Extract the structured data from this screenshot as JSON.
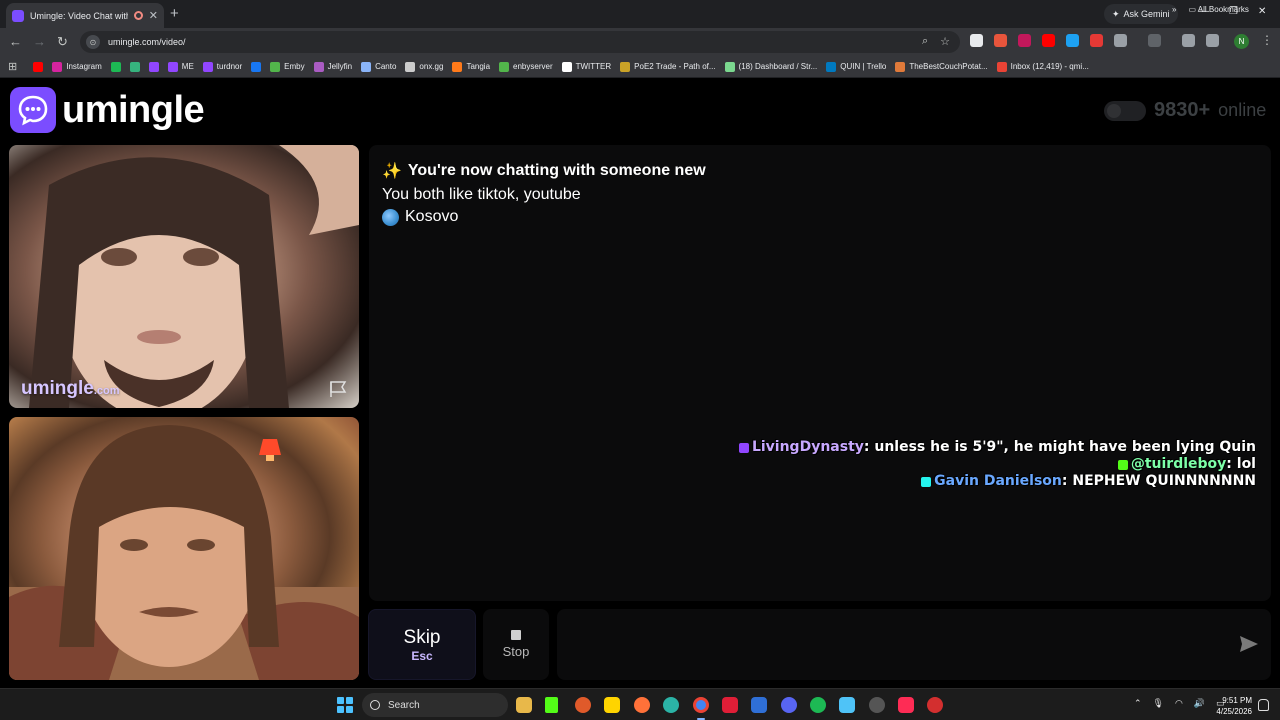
{
  "browser": {
    "tab_title": "Umingle: Video Chat with S",
    "url": "umingle.com/video/",
    "ask_gemini": "Ask Gemini",
    "profile_initial": "N",
    "bookmarks": [
      {
        "label": "",
        "color": "#ff0000"
      },
      {
        "label": "Instagram",
        "color": "#d6249f"
      },
      {
        "label": "",
        "color": "#1db954"
      },
      {
        "label": "",
        "color": "#36b37e"
      },
      {
        "label": "",
        "color": "#9146ff"
      },
      {
        "label": "ME",
        "color": "#9146ff"
      },
      {
        "label": "turdnor",
        "color": "#9146ff"
      },
      {
        "label": "",
        "color": "#1877f2"
      },
      {
        "label": "Emby",
        "color": "#52b54b"
      },
      {
        "label": "Jellyfin",
        "color": "#aa5cc3"
      },
      {
        "label": "Canto",
        "color": "#8ab4f8"
      },
      {
        "label": "onx.gg",
        "color": "#cccccc"
      },
      {
        "label": "Tangia",
        "color": "#ff7a1a"
      },
      {
        "label": "enbyserver",
        "color": "#52b54b"
      },
      {
        "label": "TWITTER",
        "color": "#ffffff"
      },
      {
        "label": "PoE2 Trade - Path of...",
        "color": "#c9a227"
      },
      {
        "label": "(18) Dashboard / Str...",
        "color": "#7bd88f"
      },
      {
        "label": "QUIN | Trello",
        "color": "#0079bf"
      },
      {
        "label": "TheBestCouchPotat...",
        "color": "#e07a3a"
      },
      {
        "label": "Inbox (12,419) - qmi...",
        "color": "#ea4335"
      }
    ],
    "all_bookmarks": "All Bookmarks"
  },
  "site": {
    "logo_text": "umingle",
    "online_count": "9830+",
    "online_label": "online",
    "watermark_main": "umingle",
    "watermark_tld": ".com",
    "accent": "#7b4dff"
  },
  "chat": {
    "sparkle": "✨",
    "system_title": "You're now chatting with someone new",
    "interests": "You both like tiktok, youtube",
    "country": "Kosovo"
  },
  "overlay_messages": [
    {
      "user": "LivingDynasty",
      "text": ": unless he is 5'9\", he might have been lying Quin",
      "user_color": "#c8a8ff",
      "badge_color": "#9146ff"
    },
    {
      "user": "@tuirdleboy",
      "text": ": lol",
      "user_color": "#7dffa8",
      "badge_color": "#53fc18"
    },
    {
      "user": "Gavin Danielson",
      "text": ": NEPHEW QUINNNNNNN",
      "user_color": "#6aa8ff",
      "badge_color": "#25f4ee"
    }
  ],
  "controls": {
    "skip_label": "Skip",
    "skip_key": "Esc",
    "stop_label": "Stop",
    "message_placeholder": ""
  },
  "taskbar": {
    "search_label": "Search",
    "time": "9:51 PM",
    "date": "4/25/2026"
  }
}
